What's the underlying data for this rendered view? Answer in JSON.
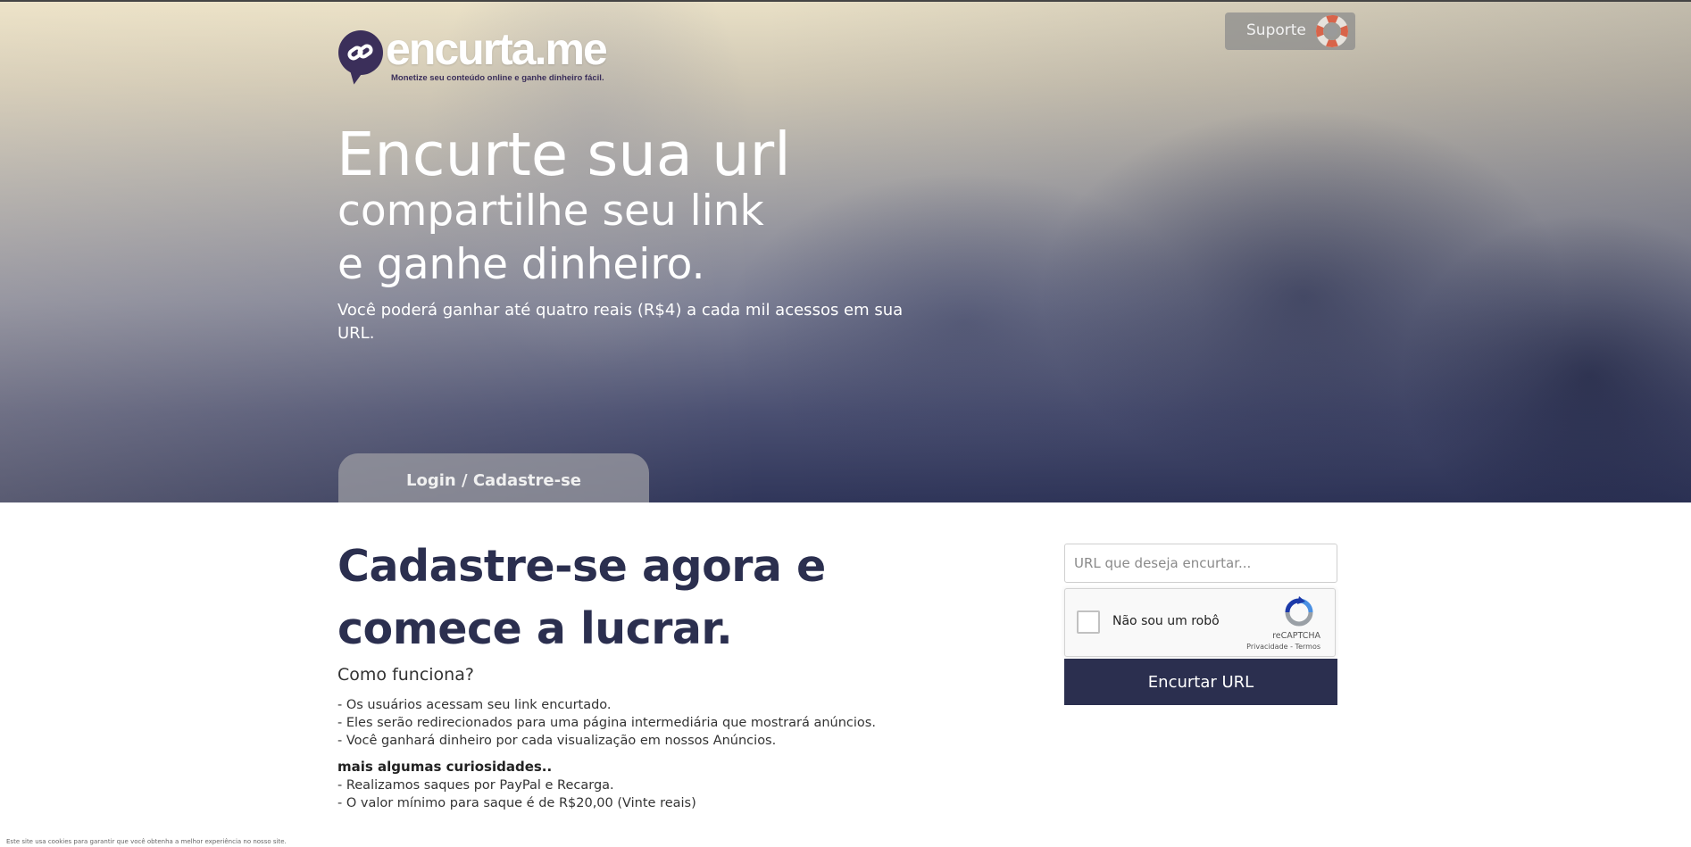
{
  "header": {
    "logo_text": "encurta.me",
    "logo_tagline": "Monetize seu conteúdo online e ganhe dinheiro fácil.",
    "support_label": "Suporte"
  },
  "hero": {
    "headline": "Encurte sua url",
    "line2": "compartilhe seu link",
    "line3": "e ganhe dinheiro.",
    "subtext": "Você poderá ganhar até quatro reais (R$4) a cada mil acessos em sua URL.",
    "login_tab_label": "Login / Cadastre-se"
  },
  "content": {
    "signup_heading": "Cadastre-se agora e comece a lucrar.",
    "how_title": "Como funciona?",
    "how_items": [
      "- Os usuários acessam seu link encurtado.",
      "- Eles serão redirecionados para uma página intermediária que mostrará anúncios.",
      "- Você ganhará dinheiro por cada visualização em nossos Anúncios."
    ],
    "extra_title": "mais algumas curiosidades..",
    "extra_items": [
      "- Realizamos saques por PayPal e Recarga.",
      "- O valor mínimo para saque é de R$20,00 (Vinte reais)"
    ]
  },
  "form": {
    "url_placeholder": "URL que deseja encurtar...",
    "url_value": "",
    "recaptcha_label": "Não sou um robô",
    "recaptcha_brand": "reCAPTCHA",
    "recaptcha_terms": "Privacidade - Termos",
    "submit_label": "Encurtar URL"
  },
  "footer": {
    "cookie_note": "Este site usa cookies para garantir que você obtenha a melhor experiência no nosso site."
  },
  "colors": {
    "brand_dark": "#2b2f4f",
    "logo_purple": "#3b2f5a",
    "support_bg": "#8c8c8c"
  },
  "icons": {
    "logo": "chain-link-icon",
    "support": "lifebuoy-icon",
    "captcha": "recaptcha-icon"
  }
}
